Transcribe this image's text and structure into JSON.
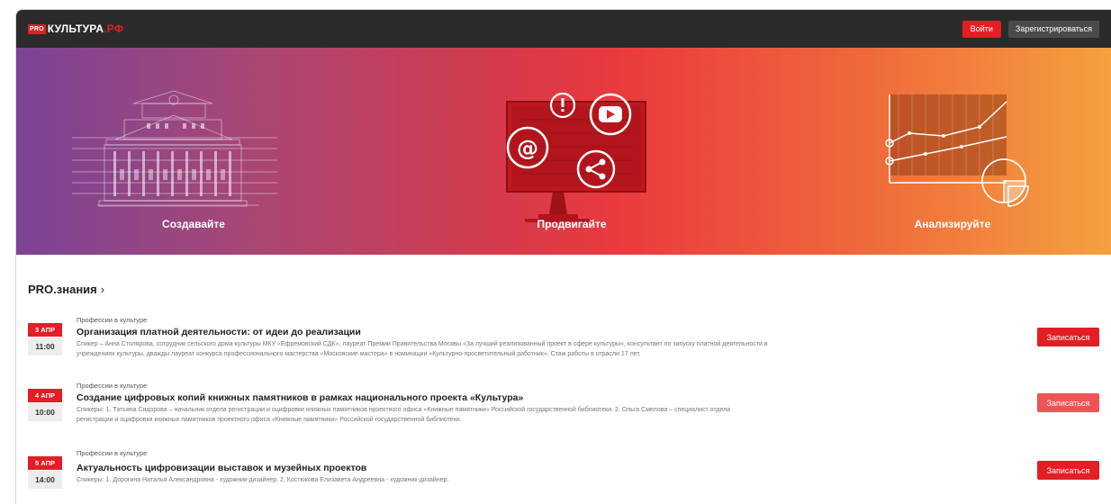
{
  "header": {
    "logo_badge": "PRO",
    "logo_name": "КУЛЬТУРА",
    "logo_suffix": ".РФ",
    "login_label": "Войти",
    "register_label": "Зарегистрироваться"
  },
  "hero": {
    "col1_label": "Создавайте",
    "col2_label": "Продвигайте",
    "col3_label": "Анализируйте"
  },
  "section": {
    "title": "PRO.знания",
    "chevron": "›"
  },
  "events": [
    {
      "date": "3 АПР",
      "time": "11:00",
      "category": "Профессии в культуре",
      "title": "Организация платной деятельности: от идеи до реализации",
      "desc1": "Спикер – Анна Столярова, сотрудник сельского дома культуры МКУ «Ефремовский СДК», лауреат Премии Правительства Москвы «За лучший реализованный проект в сфере культуры», консультант по запуску платной деятельности в",
      "desc2": "учреждениях культуры, дважды лауреат конкурса профессионального мастерства «Московские мастера» в номинации «Культурно-просветительный работник». Стаж работы в отрасли 17 лет.",
      "button": "Записаться"
    },
    {
      "date": "4 АПР",
      "time": "10:00",
      "category": "Профессии в культуре",
      "title": "Создание цифровых копий книжных памятников в рамках национального проекта «Культура»",
      "desc1": "Спикеры: 1. Татьяна Сидорова – начальник отдела регистрации и оцифровки книжных памятников проектного офиса «Книжные памятники» Российской государственной библиотеки. 2. Ольга Смелова – специалист отдела",
      "desc2": "регистрации и оцифровки книжных памятников проектного офиса «Книжные памятники» Российской государственной библиотеки.",
      "button": "Записаться"
    },
    {
      "date": "5 АПР",
      "time": "14:00",
      "category": "Профессии в культуре",
      "title": "Актуальность цифровизации выставок и музейных проектов",
      "desc1": "Спикеры: 1. Дорогина Наталья Александровна - художник-дизайнер. 2. Костюкова Елизавета Андреевна - художник-дизайнер.",
      "desc2": "",
      "button": "Записаться"
    }
  ],
  "colors": {
    "brand_red": "#e31e24",
    "topbar_bg": "#2b2b2b"
  }
}
